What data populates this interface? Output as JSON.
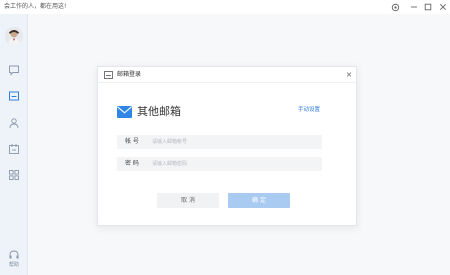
{
  "app": {
    "title": "会工作的人，都在用这!"
  },
  "window_controls": {
    "settings_icon": "gear-icon",
    "minimize_icon": "minimize-icon",
    "maximize_icon": "maximize-icon",
    "close_icon": "close-icon"
  },
  "sidebar": {
    "items": [
      {
        "icon": "chat-icon"
      },
      {
        "icon": "mail-icon",
        "active": true
      },
      {
        "icon": "contacts-icon"
      },
      {
        "icon": "calendar-icon"
      },
      {
        "icon": "apps-grid-icon"
      }
    ],
    "help_label": "帮助"
  },
  "dialog": {
    "title": "邮箱登录",
    "close_glyph": "×",
    "provider_name": "其他邮箱",
    "manual_setup": "手动设置",
    "account": {
      "label": "帐 号",
      "placeholder": "请输入邮箱帐号",
      "value": ""
    },
    "password": {
      "label": "密 码",
      "placeholder": "请输入邮箱密码",
      "value": ""
    },
    "cancel_label": "取 消",
    "confirm_label": "确 定"
  },
  "colors": {
    "accent": "#2f7de1",
    "sidebar_bg": "#eef3fa",
    "confirm_disabled": "#a9cbf1"
  }
}
